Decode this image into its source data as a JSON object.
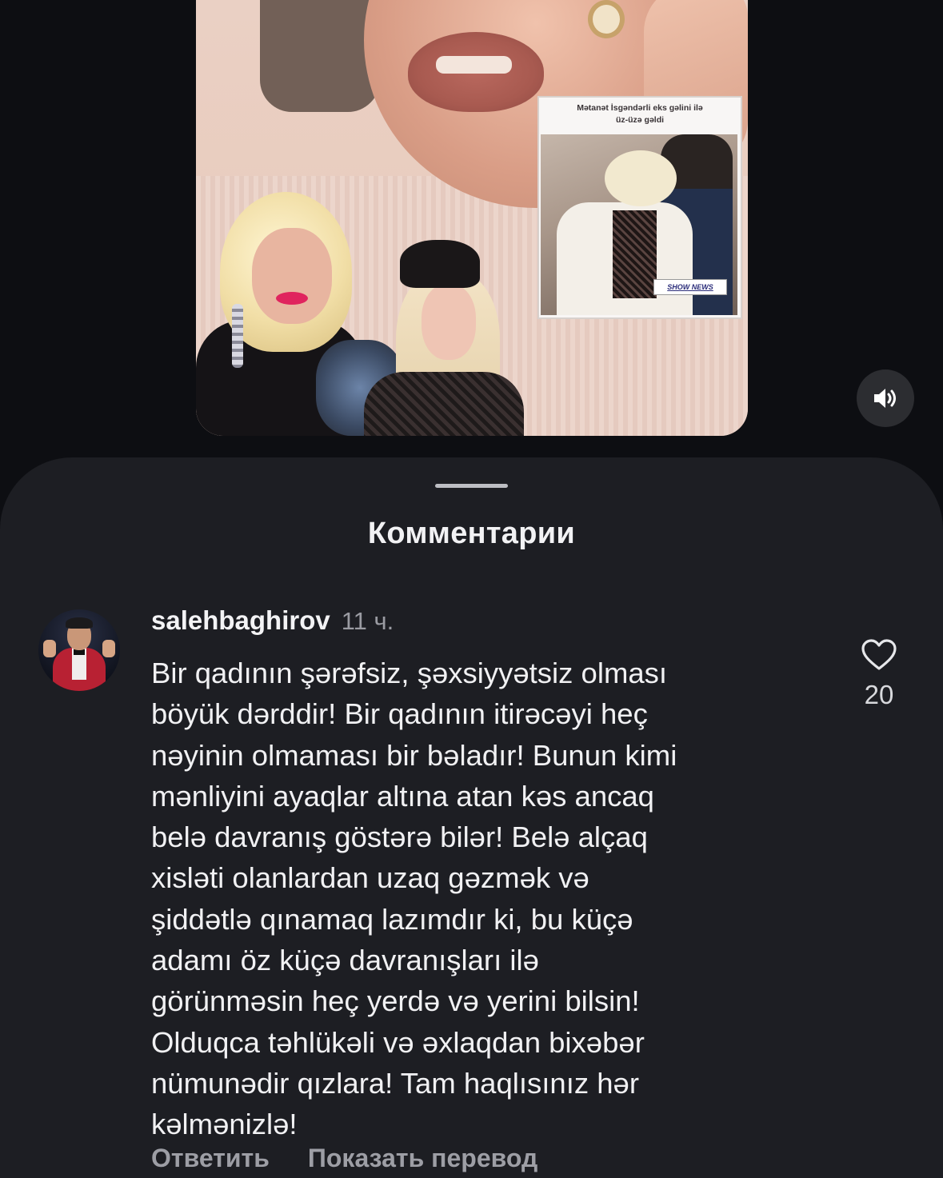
{
  "video": {
    "inset_caption": "Mətanət İsgəndərli eks gəlini ilə\nüz-üzə gəldi",
    "inset_logo": "SHOW NEWS",
    "sound_button_icon": "speaker-icon"
  },
  "comments_sheet": {
    "title": "Комментарии",
    "comment": {
      "username": "salehbaghirov",
      "time": "11 ч.",
      "text": "Bir qadının şərəfsiz, şəxsiyyətsiz olması\nböyük dərddir! Bir qadının itirəcəyi heç\nnəyinin olmaması bir bəladır! Bunun kimi\nmənliyini ayaqlar altına atan kəs ancaq\nbelə davranış göstərə bilər!  Belə alçaq\nxisləti olanlardan uzaq gəzmək və\nşiddətlə qınamaq lazımdır ki, bu küçə\nadamı öz küçə davranışları ilə\ngörünməsin heç yerdə və yerini bilsin!\nOlduqca təhlükəli və əxlaqdan bixəbər\nnümunədir qızlara! Tam haqlısınız hər\nkəlmənizlə!",
      "like_icon": "heart-icon",
      "like_count": "20",
      "reply_label": "Ответить",
      "translate_label": "Показать перевод"
    }
  },
  "colors": {
    "background": "#0d0e12",
    "sheet": "#1d1e23",
    "text_primary": "#f1f1f3",
    "text_secondary": "#9d9ea5"
  }
}
